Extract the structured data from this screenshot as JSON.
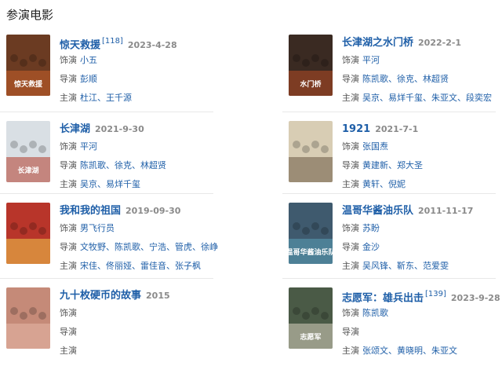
{
  "section": {
    "title": "参演电影"
  },
  "labels": {
    "role": "饰演",
    "director": "导演",
    "cast": "主演"
  },
  "movies": [
    {
      "title": "惊天救援",
      "ref": "[118]",
      "date": "2023-4-28",
      "role": "小五",
      "director": "彭顺",
      "cast": "杜江、王千源"
    },
    {
      "title": "长津湖之水门桥",
      "ref": "",
      "date": "2022-2-1",
      "role": "平河",
      "director": "陈凯歌、徐克、林超贤",
      "cast": "吴京、易烊千玺、朱亚文、段奕宏"
    },
    {
      "title": "长津湖",
      "ref": "",
      "date": "2021-9-30",
      "role": "平河",
      "director": "陈凯歌、徐克、林超贤",
      "cast": "吴京、易烊千玺"
    },
    {
      "title": "1921",
      "ref": "",
      "date": "2021-7-1",
      "role": "张国焘",
      "director": "黄建新、郑大圣",
      "cast": "黄轩、倪妮"
    },
    {
      "title": "我和我的祖国",
      "ref": "",
      "date": "2019-09-30",
      "role": "男飞行员",
      "director": "文牧野、陈凯歌、宁浩、管虎、徐峥",
      "cast": "宋佳、佟丽娅、雷佳音、张子枫"
    },
    {
      "title": "温哥华酱油乐队",
      "ref": "",
      "date": "2011-11-17",
      "role": "苏盼",
      "director": "金沙",
      "cast": "吴风锋、靳东、范爱雯"
    },
    {
      "title": "九十枚硬币的故事",
      "ref": "",
      "date": "2015",
      "role": "",
      "director": "",
      "cast": ""
    },
    {
      "title": "志愿军：雄兵出击",
      "ref": "[139]",
      "date": "2023-9-28",
      "role": "陈凯歌",
      "director": "",
      "cast": "张颂文、黄晓明、朱亚文"
    }
  ],
  "posters": [
    {
      "name": "poster-jingtian",
      "text": "惊天救援",
      "bg": "#6b3b22",
      "accent": "#c8612a"
    },
    {
      "name": "poster-shuimenqiao",
      "text": "水门桥",
      "bg": "#3a2a22",
      "accent": "#b54a24"
    },
    {
      "name": "poster-changjinhu",
      "text": "长津湖",
      "bg": "#d9dfe4",
      "accent": "#b23a2a"
    },
    {
      "name": "poster-1921",
      "text": "",
      "bg": "#d8cdb4",
      "accent": "#6b5a44"
    },
    {
      "name": "poster-zuguo",
      "text": "",
      "bg": "#b8352a",
      "accent": "#f0c84a"
    },
    {
      "name": "poster-wengehua",
      "text": "温哥华酱油乐队",
      "bg": "#3f5a6e",
      "accent": "#5aa0b8"
    },
    {
      "name": "poster-jiushimei",
      "text": "",
      "bg": "#c58a78",
      "accent": "#e6b8a8"
    },
    {
      "name": "poster-zhiyuanjun",
      "text": "志愿军",
      "bg": "#4a5a46",
      "accent": "#d8d2c0"
    }
  ]
}
